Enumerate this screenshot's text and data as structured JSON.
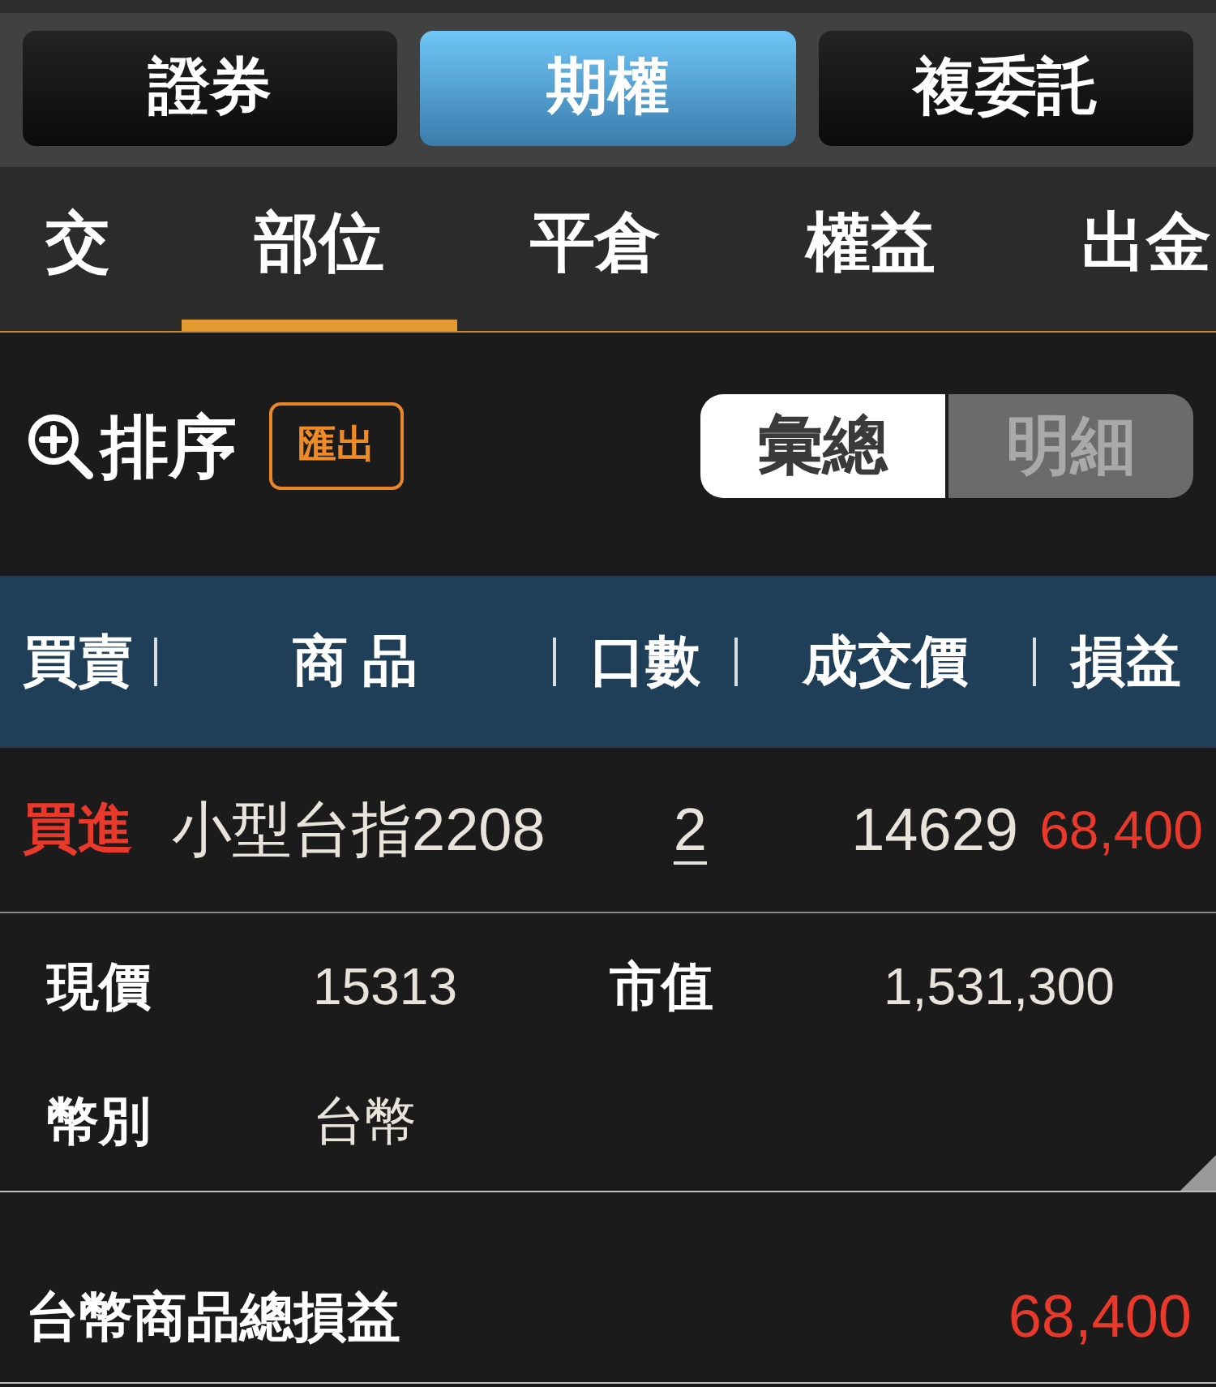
{
  "segments": [
    {
      "label": "證券",
      "selected": false
    },
    {
      "label": "期權",
      "selected": true
    },
    {
      "label": "複委託",
      "selected": false
    }
  ],
  "tabs": [
    {
      "label": "交",
      "selected": false
    },
    {
      "label": "部位",
      "selected": true
    },
    {
      "label": "平倉",
      "selected": false
    },
    {
      "label": "權益",
      "selected": false
    },
    {
      "label": "出金",
      "selected": false
    }
  ],
  "toolbar": {
    "sort_label": "排序",
    "export_button": "匯出",
    "view_toggle": [
      {
        "label": "彙總",
        "selected": true
      },
      {
        "label": "明細",
        "selected": false
      }
    ]
  },
  "table": {
    "columns": [
      "買賣",
      "商 品",
      "口數",
      "成交價",
      "損益"
    ],
    "rows": [
      {
        "side": "買進",
        "product": "小型台指2208",
        "quantity": "2",
        "price": "14629",
        "pnl": "68,400",
        "expanded": true,
        "details": [
          {
            "label": "現價",
            "value": "15313"
          },
          {
            "label": "市值",
            "value": "1,531,300"
          },
          {
            "label": "幣別",
            "value": "台幣"
          }
        ]
      }
    ]
  },
  "summary": {
    "label": "台幣商品總損益",
    "value": "68,400"
  }
}
